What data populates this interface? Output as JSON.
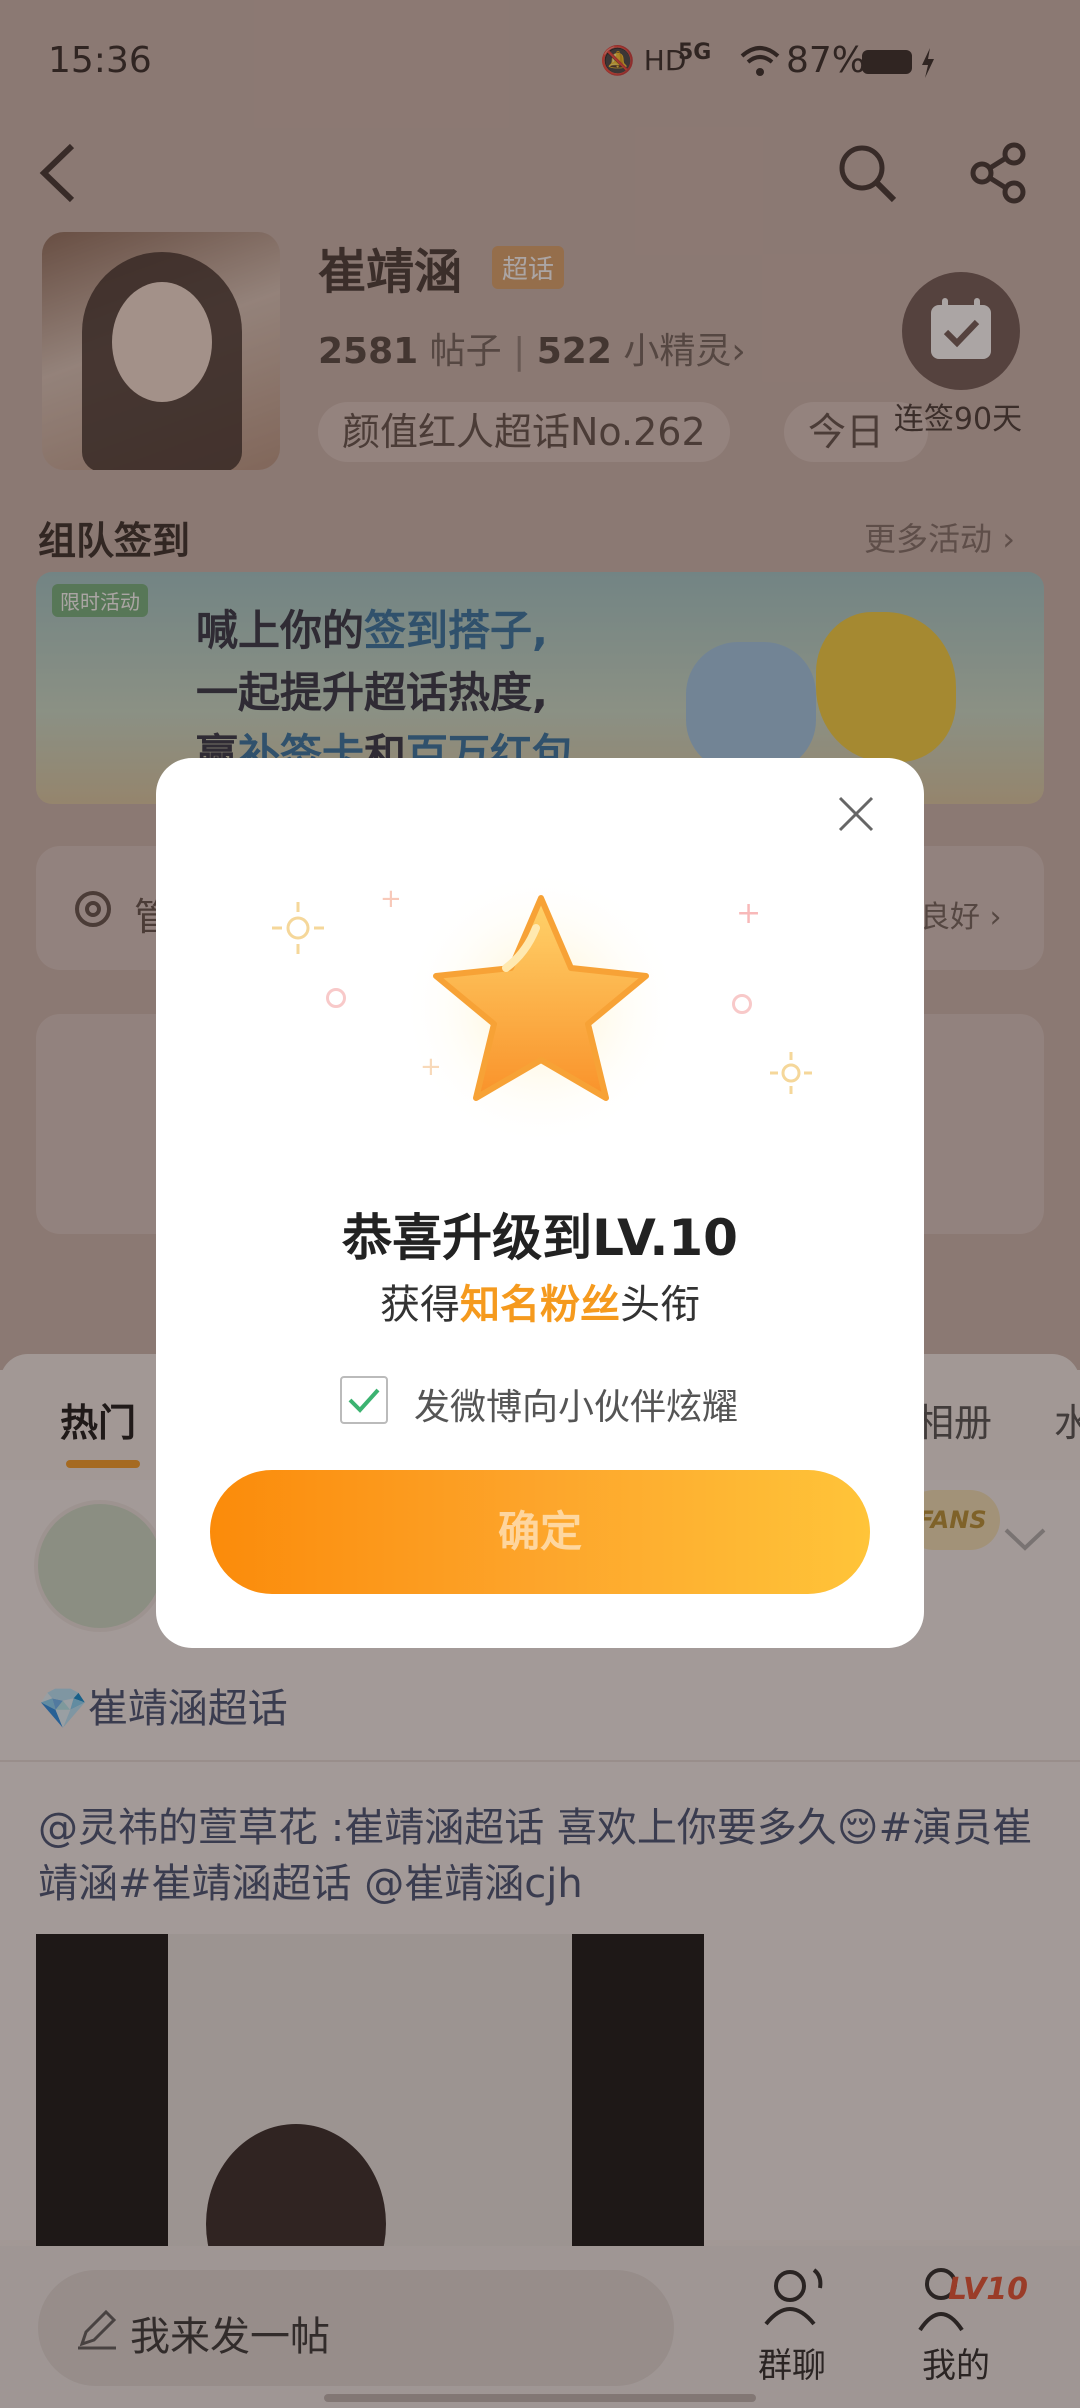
{
  "status_bar": {
    "time": "15:36",
    "battery": "87%",
    "network": "5G"
  },
  "header": {
    "back_icon": "back-arrow-icon",
    "search_icon": "search-icon",
    "share_icon": "share-icon"
  },
  "profile": {
    "name": "崔靖涵",
    "badge": "超话",
    "posts_count": "2581",
    "posts_label": "帖子",
    "fans_count": "522",
    "fans_label": "小精灵",
    "rank_pill": "颜值红人超话No.262",
    "today_pill": "今日",
    "checkin_label": "连签90天"
  },
  "team_checkin": {
    "title": "组队签到",
    "more": "更多活动",
    "banner_limit": "限时活动",
    "banner_line1_a": "喊上你的",
    "banner_line1_b": "签到搭子,",
    "banner_line2": "一起提升超话热度,",
    "banner_line3_a": "赢",
    "banner_line3_b": "补签卡",
    "banner_line3_c": "和",
    "banner_line3_d": "百万红包"
  },
  "manage_card": {
    "left_text": "管",
    "right_text": "良好"
  },
  "tabs": [
    {
      "label": "热门"
    },
    {
      "label": "相册"
    },
    {
      "label": "水"
    }
  ],
  "feed": {
    "badge_text": "FANS",
    "chaohua_link": "崔靖涵超话",
    "post_text": "@灵祎的萱草花 :崔靖涵超话 喜欢上你要多久😌#演员崔靖涵#崔靖涵超话 @崔靖涵cjh"
  },
  "bottom_bar": {
    "post_button": "我来发一帖",
    "group_chat": "群聊",
    "mine": "我的",
    "level_badge": "LV10"
  },
  "dialog": {
    "title": "恭喜升级到LV.10",
    "sub_prefix": "获得",
    "sub_highlight": "知名粉丝",
    "sub_suffix": "头衔",
    "checkbox_label": "发微博向小伙伴炫耀",
    "checkbox_checked": true,
    "confirm_button": "确定"
  },
  "colors": {
    "accent_orange": "#fb8b0a",
    "highlight": "#f59a1e",
    "link_blue": "#3d4b6d"
  }
}
